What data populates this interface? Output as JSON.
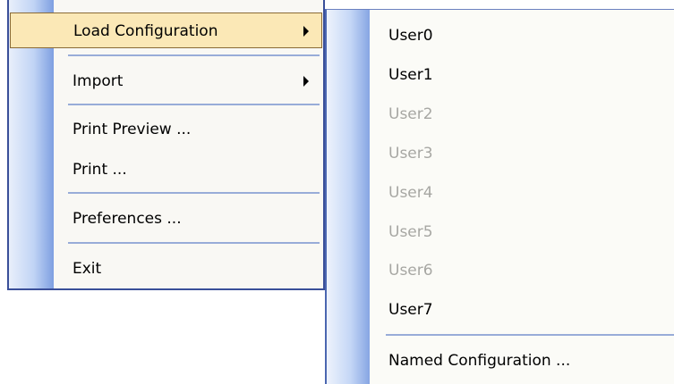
{
  "main_menu": {
    "items": [
      {
        "label": "Load Configuration",
        "has_submenu": true,
        "highlighted": true
      },
      {
        "label": "Import",
        "has_submenu": true
      },
      {
        "label": "Print Preview ..."
      },
      {
        "label": "Print ..."
      },
      {
        "label": "Preferences ..."
      },
      {
        "label": "Exit"
      }
    ]
  },
  "submenu": {
    "items": [
      {
        "label": "User0",
        "enabled": true
      },
      {
        "label": "User1",
        "enabled": true
      },
      {
        "label": "User2",
        "enabled": false
      },
      {
        "label": "User3",
        "enabled": false
      },
      {
        "label": "User4",
        "enabled": false
      },
      {
        "label": "User5",
        "enabled": false
      },
      {
        "label": "User6",
        "enabled": false
      },
      {
        "label": "User7",
        "enabled": true
      },
      {
        "label": "Named Configuration ...",
        "enabled": true
      }
    ]
  },
  "colors": {
    "highlight_fill": "#fbe8b6",
    "menu_border": "#3a4f99",
    "disabled_text": "#a7a7a3",
    "separator": "#98acd8"
  },
  "icons": {
    "submenu_arrow": "triangle-right"
  }
}
